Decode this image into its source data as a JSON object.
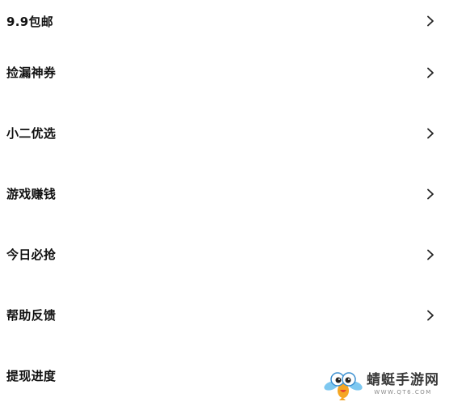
{
  "menu": {
    "items": [
      {
        "label": "9.9包邮",
        "has_chevron": true
      },
      {
        "label": "捡漏神券",
        "has_chevron": true
      },
      {
        "label": "小二优选",
        "has_chevron": true
      },
      {
        "label": "游戏赚钱",
        "has_chevron": true
      },
      {
        "label": "今日必抢",
        "has_chevron": true
      },
      {
        "label": "帮助反馈",
        "has_chevron": true
      },
      {
        "label": "提现进度",
        "has_chevron": false
      }
    ],
    "chevron_icon": "chevron-right-icon"
  },
  "watermark": {
    "title": "蜻蜓手游网",
    "url": "WWW.QT6.COM",
    "logo_icon": "dragonfly-mascot-icon"
  },
  "colors": {
    "background": "#ffffff",
    "text": "#111111",
    "chevron": "#222222"
  }
}
